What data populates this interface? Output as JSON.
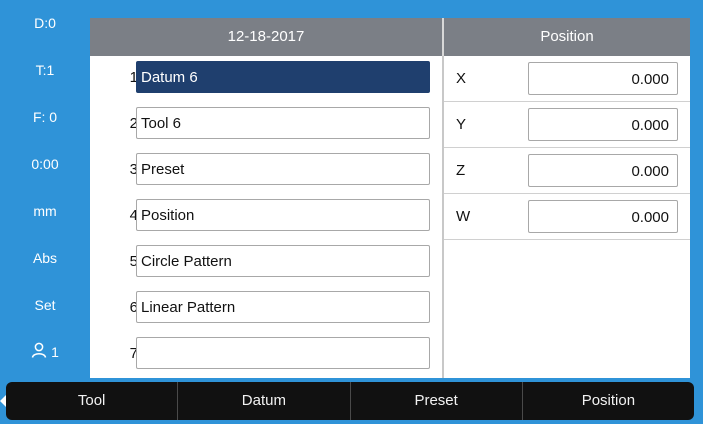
{
  "sidebar": {
    "items": [
      {
        "label": "D:0"
      },
      {
        "label": "T:1"
      },
      {
        "label": "F:  0"
      },
      {
        "label": "0:00"
      },
      {
        "label": "mm"
      },
      {
        "label": "Abs"
      },
      {
        "label": "Set"
      },
      {
        "label": "1",
        "icon": "user-icon"
      }
    ]
  },
  "header": {
    "date": "12-18-2017",
    "panel_title": "Position"
  },
  "menu": {
    "items": [
      {
        "num": "1",
        "label": "Datum 6",
        "selected": true
      },
      {
        "num": "2",
        "label": "Tool 6"
      },
      {
        "num": "3",
        "label": "Preset"
      },
      {
        "num": "4",
        "label": "Position"
      },
      {
        "num": "5",
        "label": "Circle Pattern"
      },
      {
        "num": "6",
        "label": "Linear Pattern"
      },
      {
        "num": "7",
        "label": ""
      }
    ]
  },
  "axes": [
    {
      "label": "X",
      "value": "0.000"
    },
    {
      "label": "Y",
      "value": "0.000"
    },
    {
      "label": "Z",
      "value": "0.000"
    },
    {
      "label": "W",
      "value": "0.000"
    }
  ],
  "softkeys": [
    {
      "label": "Tool"
    },
    {
      "label": "Datum"
    },
    {
      "label": "Preset"
    },
    {
      "label": "Position"
    }
  ],
  "colors": {
    "background_blue": "#2f93d8",
    "header_gray": "#7b7f86",
    "selected_navy": "#1f3f6e",
    "softkey_black": "#111111"
  }
}
